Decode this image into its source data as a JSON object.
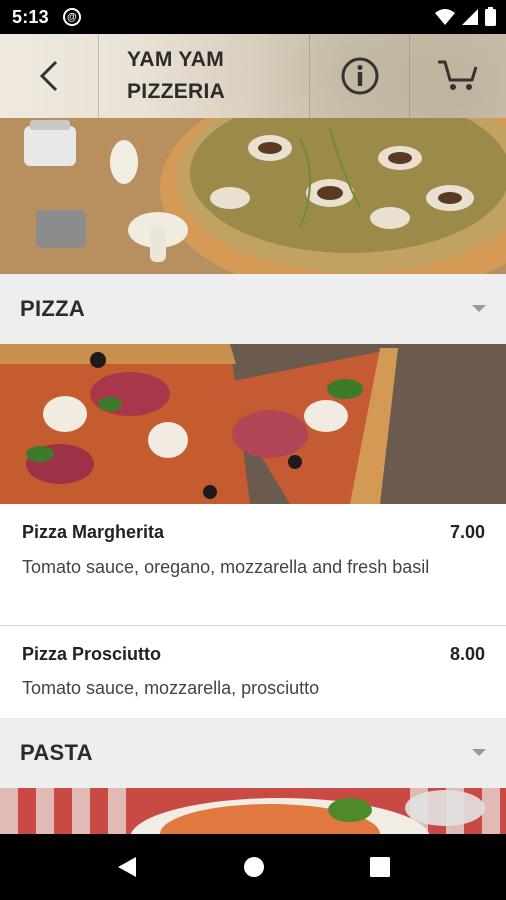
{
  "status_bar": {
    "time": "5:13"
  },
  "header": {
    "title_line1": "YAM YAM",
    "title_line2": "PIZZERIA"
  },
  "sections": [
    {
      "title": "PIZZA",
      "items": [
        {
          "name": "Pizza Margherita",
          "price": "7.00",
          "description": "Tomato sauce, oregano, mozzarella and fresh basil"
        },
        {
          "name": "Pizza Prosciutto",
          "price": "8.00",
          "description": "Tomato sauce, mozzarella, prosciutto"
        }
      ]
    },
    {
      "title": "PASTA",
      "items": []
    }
  ],
  "icons": {
    "back": "back-arrow-icon",
    "info": "info-icon",
    "cart": "cart-icon",
    "nav_back": "nav-back-icon",
    "nav_home": "nav-home-icon",
    "nav_recents": "nav-recents-icon"
  },
  "colors": {
    "section_bg": "#eeeeee",
    "status_bar": "#000000",
    "text": "#222222"
  }
}
